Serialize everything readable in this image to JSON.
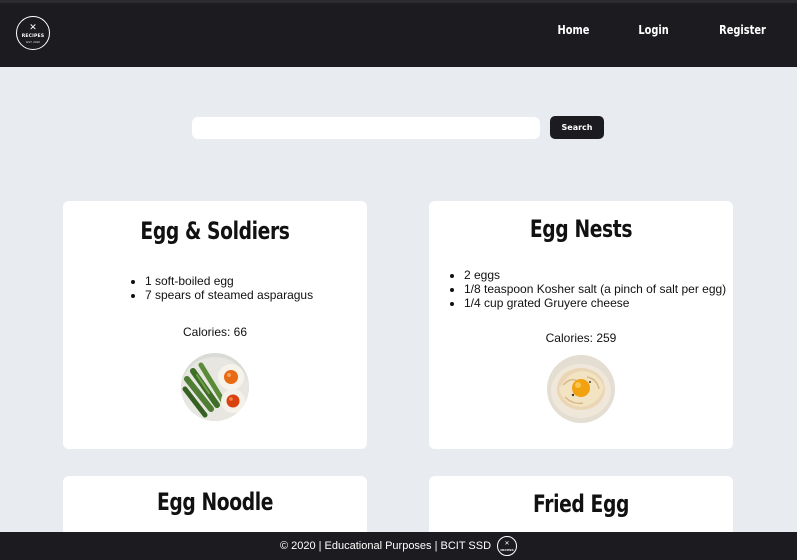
{
  "nav": {
    "logo_text": "RECIPES",
    "logo_sub": "EST. 2020",
    "links": [
      "Home",
      "Login",
      "Register"
    ]
  },
  "search": {
    "value": "",
    "placeholder": "",
    "button_label": "Search"
  },
  "recipes": [
    {
      "title": "Egg & Soldiers",
      "ingredients": [
        "1 soft-boiled egg",
        "7 spears of steamed asparagus"
      ],
      "calories": "Calories: 66",
      "image": "asparagus-and-eggs-photo"
    },
    {
      "title": "Egg Nests",
      "ingredients": [
        "2 eggs",
        "1/8 teaspoon Kosher salt (a pinch of salt per egg)",
        "1/4 cup grated Gruyere cheese"
      ],
      "calories": "Calories: 259",
      "image": "egg-nest-photo"
    },
    {
      "title": "Egg Noodle"
    },
    {
      "title": "Fried Egg"
    }
  ],
  "footer": {
    "text": "© 2020 | Educational Purposes | BCIT SSD",
    "logo_text": "RECIPES"
  },
  "colors": {
    "navbar": "#1c1b1f",
    "page_background": "#e8ebf0",
    "card": "#ffffff"
  }
}
